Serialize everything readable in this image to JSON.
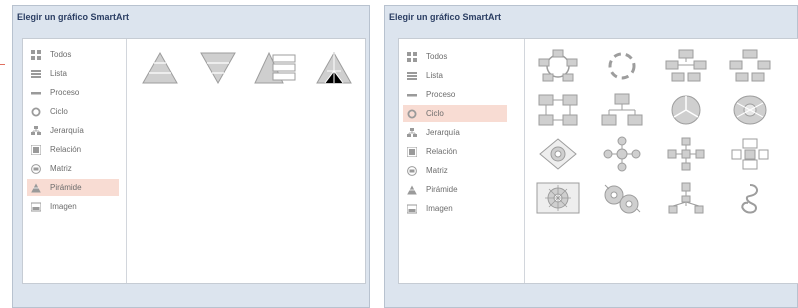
{
  "dialog1": {
    "title": "Elegir un gráfico SmartArt",
    "categories": [
      {
        "label": "Todos",
        "icon": "all-icon"
      },
      {
        "label": "Lista",
        "icon": "list-icon"
      },
      {
        "label": "Proceso",
        "icon": "process-icon"
      },
      {
        "label": "Ciclo",
        "icon": "cycle-icon"
      },
      {
        "label": "Jerarquía",
        "icon": "hierarchy-icon"
      },
      {
        "label": "Relación",
        "icon": "relationship-icon"
      },
      {
        "label": "Matriz",
        "icon": "matrix-icon"
      },
      {
        "label": "Pirámide",
        "icon": "pyramid-icon"
      },
      {
        "label": "Imagen",
        "icon": "picture-icon"
      }
    ],
    "selected_index": 7,
    "gallery": [
      "basic-pyramid",
      "inverted-pyramid",
      "pyramid-list",
      "segmented-pyramid"
    ]
  },
  "dialog2": {
    "title": "Elegir un gráfico SmartArt",
    "categories": [
      {
        "label": "Todos",
        "icon": "all-icon"
      },
      {
        "label": "Lista",
        "icon": "list-icon"
      },
      {
        "label": "Proceso",
        "icon": "process-icon"
      },
      {
        "label": "Ciclo",
        "icon": "cycle-icon"
      },
      {
        "label": "Jerarquía",
        "icon": "hierarchy-icon"
      },
      {
        "label": "Relación",
        "icon": "relationship-icon"
      },
      {
        "label": "Matriz",
        "icon": "matrix-icon"
      },
      {
        "label": "Pirámide",
        "icon": "pyramid-icon"
      },
      {
        "label": "Imagen",
        "icon": "picture-icon"
      }
    ],
    "selected_index": 3,
    "gallery": [
      "basic-cycle",
      "segmented-cycle",
      "block-cycle",
      "nondirectional-cycle",
      "continuous-cycle",
      "text-cycle",
      "basic-pie",
      "basic-radial",
      "diverging-radial",
      "radial-cycle",
      "radial-cluster",
      "cycle-matrix",
      "gear",
      "multidirectional-cycle",
      "radial-venn",
      "spiral"
    ]
  },
  "colors": {
    "selected_bg": "#f8dcd3",
    "title_text": "#2b3e63",
    "icon": "#9a9a9a"
  }
}
